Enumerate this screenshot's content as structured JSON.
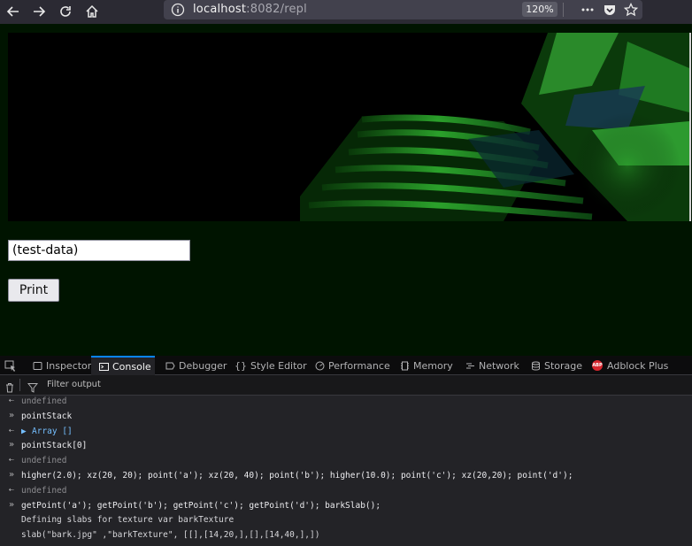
{
  "browser": {
    "url_host": "localhost",
    "url_rest": ":8082/repl",
    "zoom": "120%"
  },
  "page": {
    "input_value": "(test-data)",
    "print_label": "Print"
  },
  "devtools": {
    "tabs": [
      "Inspector",
      "Console",
      "Debugger",
      "Style Editor",
      "Performance",
      "Memory",
      "Network",
      "Storage",
      "Adblock Plus"
    ],
    "active_tab": "Console",
    "filter_placeholder": "Filter output",
    "lines": [
      {
        "kind": "result",
        "text": "undefined"
      },
      {
        "kind": "input",
        "text": "pointStack"
      },
      {
        "kind": "array",
        "text": "Array []"
      },
      {
        "kind": "input",
        "text": "pointStack[0]"
      },
      {
        "kind": "result",
        "text": "undefined"
      },
      {
        "kind": "input",
        "text": "higher(2.0); xz(20, 20); point('a'); xz(20, 40); point('b'); higher(10.0); point('c'); xz(20,20); point('d');"
      },
      {
        "kind": "result",
        "text": "undefined"
      },
      {
        "kind": "input",
        "text": "getPoint('a'); getPoint('b'); getPoint('c'); getPoint('d'); barkSlab();"
      },
      {
        "kind": "log",
        "text": "Defining slabs for texture var barkTexture"
      },
      {
        "kind": "log",
        "text": "slab(\"bark.jpg\" ,\"barkTexture\", [[],[14,20,],[],[14,40,],])"
      }
    ]
  }
}
